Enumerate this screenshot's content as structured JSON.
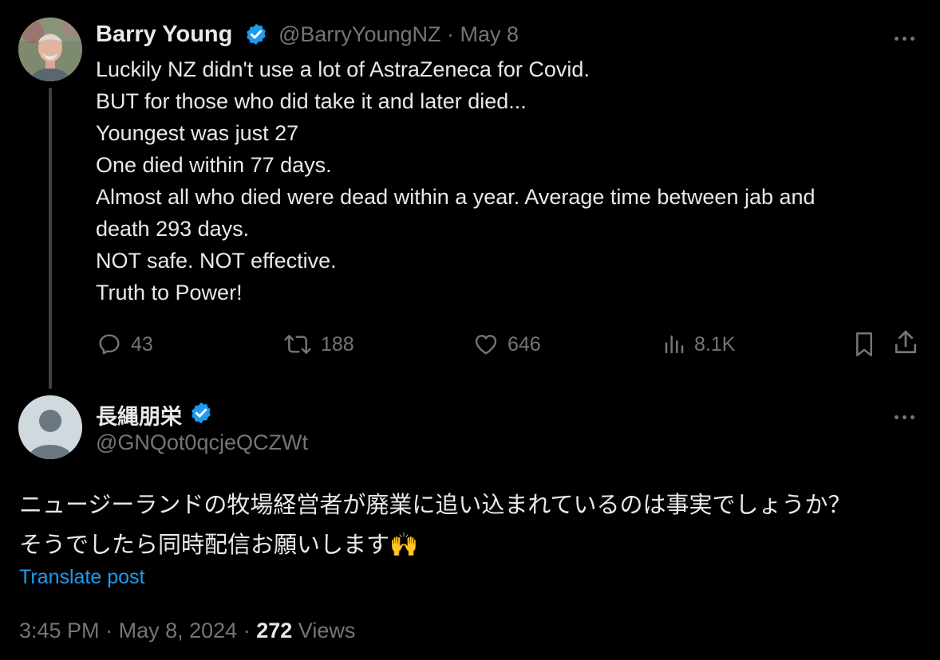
{
  "parent_tweet": {
    "author_name": "Barry Young",
    "handle": "@BarryYoungNZ",
    "separator": "·",
    "date": "May 8",
    "verified_icon": "verified-badge-icon",
    "more_icon": "more-options-icon",
    "lines": [
      "Luckily NZ didn't use a lot of AstraZeneca for Covid.",
      "BUT for those who did take it and later died...",
      "Youngest was just 27",
      "One died within 77 days.",
      "Almost all who died were dead within a year.  Average time between jab and",
      "death 293 days.",
      "NOT safe.  NOT effective.",
      "Truth to Power!"
    ],
    "actions": {
      "replies": "43",
      "reposts": "188",
      "likes": "646",
      "views": "8.1K"
    }
  },
  "reply_tweet": {
    "author_name": "長縄朋栄",
    "handle": "@GNQot0qcjeQCZWt",
    "lines": [
      "ニュージーランドの牧場経営者が廃業に追い込まれているのは事実でしょうか？",
      "そうでしたら同時配信お願いします🙌"
    ],
    "translate_label": "Translate post",
    "time": "3:45 PM",
    "separator": "·",
    "date": "May 8, 2024",
    "views_count": "272",
    "views_label": "Views"
  },
  "colors": {
    "background": "#000000",
    "primary_text": "#e7e9ea",
    "secondary_text": "#71767b",
    "accent": "#1d9bf0",
    "thread_line": "#3e4144"
  }
}
